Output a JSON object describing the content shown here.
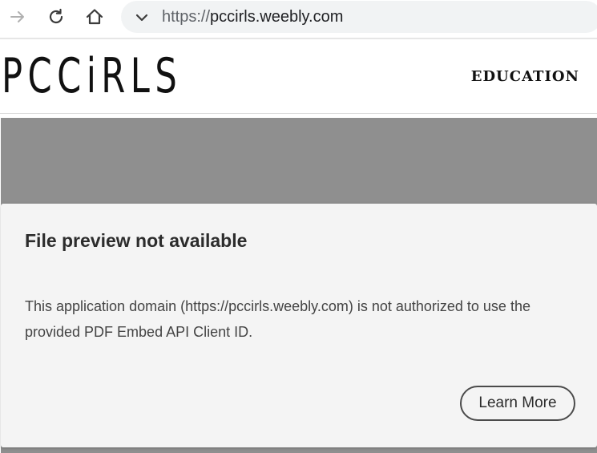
{
  "browser": {
    "url_scheme": "https://",
    "url_host": "pccirls.weebly.com"
  },
  "site": {
    "logo": "PCCiRLS",
    "nav_education": "EDUCATION"
  },
  "dialog": {
    "title": "File preview not available",
    "message": "This application domain (https://pccirls.weebly.com) is not authorized to use the provided PDF Embed API Client ID.",
    "learn_more_label": "Learn More"
  },
  "icons": [
    "forward-icon",
    "reload-icon",
    "home-icon",
    "chevron-down-icon"
  ],
  "colors": {
    "embed_background": "#8f8f8f",
    "dialog_background": "#f4f4f4",
    "omnibox_background": "#f1f3f4"
  }
}
